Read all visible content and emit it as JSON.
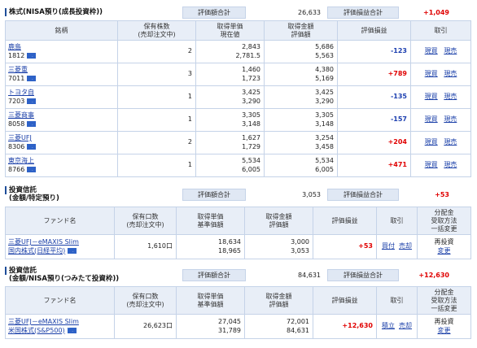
{
  "stocks": {
    "title": "株式(NISA預り(成長投資枠))",
    "eval_total_label": "評価額合計",
    "eval_total": "26,633",
    "pl_total_label": "評価損益合計",
    "pl_total": "+1,049",
    "headers": {
      "name": "銘柄",
      "qty": "保有株数\n(売却注文中)",
      "unit": "取得単価\n現在値",
      "amount": "取得金額\n評価額",
      "pl": "評価損益",
      "trade": "取引"
    },
    "rows": [
      {
        "name": "鹿島",
        "code": "1812",
        "qty": "2",
        "cost": "2,843",
        "price": "2,781.5",
        "buy_amt": "5,686",
        "value": "5,563",
        "pl": "-123",
        "pl_color": "blue",
        "action1": "現買",
        "action2": "現売"
      },
      {
        "name": "三菱重",
        "code": "7011",
        "qty": "3",
        "cost": "1,460",
        "price": "1,723",
        "buy_amt": "4,380",
        "value": "5,169",
        "pl": "+789",
        "pl_color": "red",
        "action1": "現買",
        "action2": "現売"
      },
      {
        "name": "トヨタ自",
        "code": "7203",
        "qty": "1",
        "cost": "3,425",
        "price": "3,290",
        "buy_amt": "3,425",
        "value": "3,290",
        "pl": "-135",
        "pl_color": "blue",
        "action1": "現買",
        "action2": "現売"
      },
      {
        "name": "三菱商事",
        "code": "8058",
        "qty": "1",
        "cost": "3,305",
        "price": "3,148",
        "buy_amt": "3,305",
        "value": "3,148",
        "pl": "-157",
        "pl_color": "blue",
        "action1": "現買",
        "action2": "現売"
      },
      {
        "name": "三菱UFJ",
        "code": "8306",
        "qty": "2",
        "cost": "1,627",
        "price": "1,729",
        "buy_amt": "3,254",
        "value": "3,458",
        "pl": "+204",
        "pl_color": "red",
        "action1": "現買",
        "action2": "現売"
      },
      {
        "name": "東京海上",
        "code": "8766",
        "qty": "1",
        "cost": "5,534",
        "price": "6,005",
        "buy_amt": "5,534",
        "value": "6,005",
        "pl": "+471",
        "pl_color": "red",
        "action1": "現買",
        "action2": "現売"
      }
    ]
  },
  "fund1": {
    "title_line1": "投資信託",
    "title_line2": "(金額/特定預り)",
    "eval_total_label": "評価額合計",
    "eval_total": "3,053",
    "pl_total_label": "評価損益合計",
    "pl_total": "+53",
    "headers": {
      "name": "ファンド名",
      "qty": "保有口数\n(売却注文中)",
      "unit": "取得単価\n基準価額",
      "amount": "取得金額\n評価額",
      "pl": "評価損益",
      "trade": "取引",
      "dist": "分配金\n受取方法\n一括変更"
    },
    "rows": [
      {
        "name1": "三菱UFJ－eMAXIS Slim",
        "name2": "国内株式(日経平均)",
        "qty": "1,610口",
        "cost": "18,634",
        "nav": "18,965",
        "buy_amt": "3,000",
        "value": "3,053",
        "pl": "+53",
        "action1": "買付",
        "action2": "売却",
        "dist1": "再投資",
        "dist2": "変更"
      }
    ]
  },
  "fund2": {
    "title_line1": "投資信託",
    "title_line2": "(金額/NISA預り(つみたて投資枠))",
    "eval_total_label": "評価額合計",
    "eval_total": "84,631",
    "pl_total_label": "評価損益合計",
    "pl_total": "+12,630",
    "headers": {
      "name": "ファンド名",
      "qty": "保有口数\n(売却注文中)",
      "unit": "取得単価\n基準価額",
      "amount": "取得金額\n評価額",
      "pl": "評価損益",
      "trade": "取引",
      "dist": "分配金\n受取方法\n一括変更"
    },
    "rows": [
      {
        "name1": "三菱UFJ－eMAXIS Slim",
        "name2": "米国株式(S&P500)",
        "qty": "26,623口",
        "cost": "27,045",
        "nav": "31,789",
        "buy_amt": "72,001",
        "value": "84,631",
        "pl": "+12,630",
        "action1": "積立",
        "action2": "売却",
        "dist1": "再投資",
        "dist2": "変更"
      }
    ]
  }
}
